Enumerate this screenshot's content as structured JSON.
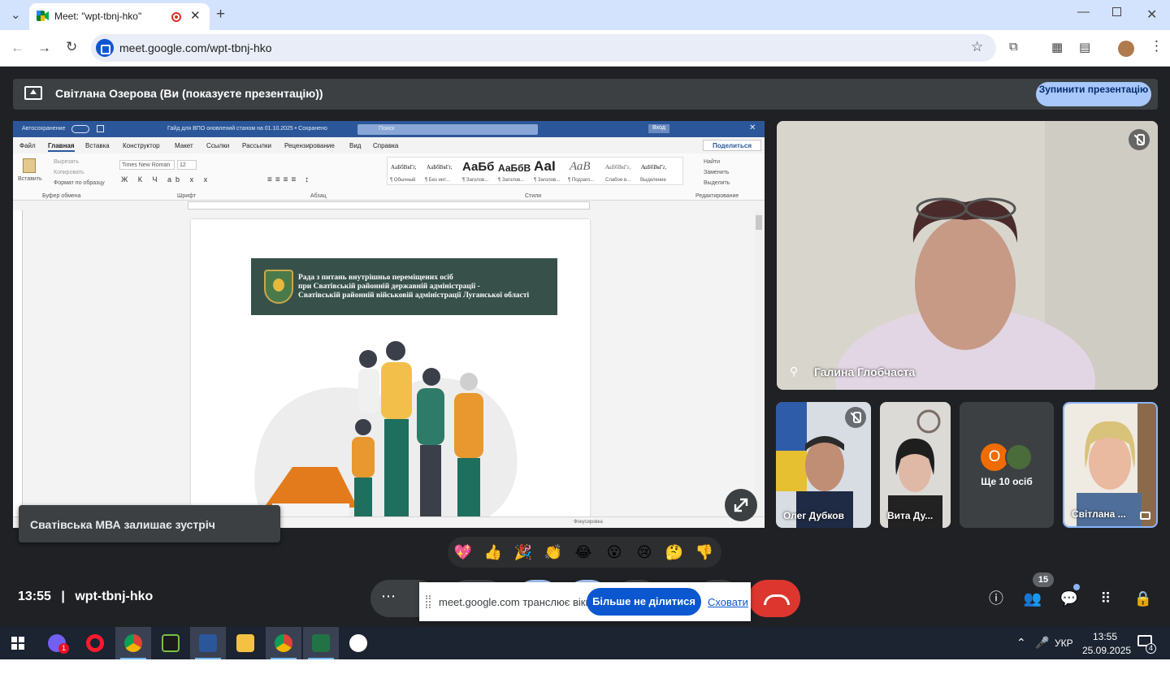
{
  "browser": {
    "tab_title": "Meet: \"wpt-tbnj-hko\"",
    "url": "meet.google.com/wpt-tbnj-hko"
  },
  "presenting": {
    "text": "Світлана Озерова (Ви (показуєте презентацію))",
    "stop_label": "Зупинити презентацію"
  },
  "word": {
    "autosave": "Автосохранение",
    "doc_title": "Гайд для ВПО оновлений станом на 01.10.2025 • Сохранено",
    "search": "Поиск",
    "signin": "Вход",
    "tabs": [
      "Файл",
      "Главная",
      "Вставка",
      "Конструктор",
      "Макет",
      "Ссылки",
      "Рассылки",
      "Рецензирование",
      "Вид",
      "Справка"
    ],
    "share": "Поделиться",
    "clipboard": {
      "paste": "Вставить",
      "cut": "Вырезать",
      "copy": "Копировать",
      "format": "Формат по образцу"
    },
    "font": {
      "name": "Times New Roman",
      "size": "12"
    },
    "group_labels": [
      "Буфер обмена",
      "Шрифт",
      "Абзац",
      "Стили",
      "Редактирование"
    ],
    "styles": [
      {
        "sample": "АаБбВвГг,",
        "name": "¶ Обычный"
      },
      {
        "sample": "АаБбВвГг,",
        "name": "¶ Без инт..."
      },
      {
        "sample": "АаБб",
        "name": "¶ Заголов..."
      },
      {
        "sample": "АаБбВ",
        "name": "¶ Заголов..."
      },
      {
        "sample": "АаI",
        "name": "¶ Заголов..."
      },
      {
        "sample": "АаВ",
        "name": "¶ Подзаго..."
      },
      {
        "sample": "АаБбВвГг,",
        "name": "Слабое в..."
      },
      {
        "sample": "АаБбВвГг,",
        "name": "Выделение"
      }
    ],
    "editing": [
      "Найти",
      "Заменить",
      "Выделить"
    ],
    "banner": [
      "Рада з питань внутрішньо переміщених осіб",
      "при Сватівській районній державній адміністрації -",
      "Сватівській районній військовій адміністрації Луганської області"
    ],
    "status": "Фокусировка"
  },
  "participants": {
    "main": "Галина Глобчаста",
    "tiles": [
      "Олег Дубков",
      "Вита Ду...",
      "Світлана ..."
    ],
    "more": "Ще 10 осіб",
    "more_avatar": "О"
  },
  "toast": "Сватівська МВА залишає зустріч",
  "reactions": [
    "💖",
    "👍",
    "🎉",
    "👏",
    "😂",
    "😮",
    "😢",
    "🤔",
    "👎"
  ],
  "bottom": {
    "time": "13:55",
    "code": "wpt-tbnj-hko",
    "people_count": "15"
  },
  "sharebar": {
    "message": "meet.google.com транслює вікно.",
    "stop": "Більше не ділитися",
    "hide": "Сховати"
  },
  "taskbar": {
    "lang": "УКР",
    "time": "13:55",
    "date": "25.09.2025",
    "notif": "4",
    "viber_badge": "1"
  }
}
